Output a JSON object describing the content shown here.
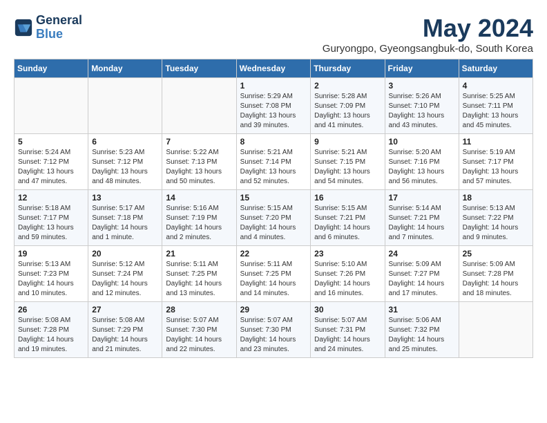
{
  "logo": {
    "line1": "General",
    "line2": "Blue"
  },
  "title": "May 2024",
  "subtitle": "Guryongpo, Gyeongsangbuk-do, South Korea",
  "weekdays": [
    "Sunday",
    "Monday",
    "Tuesday",
    "Wednesday",
    "Thursday",
    "Friday",
    "Saturday"
  ],
  "weeks": [
    [
      {
        "day": "",
        "sunrise": "",
        "sunset": "",
        "daylight": ""
      },
      {
        "day": "",
        "sunrise": "",
        "sunset": "",
        "daylight": ""
      },
      {
        "day": "",
        "sunrise": "",
        "sunset": "",
        "daylight": ""
      },
      {
        "day": "1",
        "sunrise": "Sunrise: 5:29 AM",
        "sunset": "Sunset: 7:08 PM",
        "daylight": "Daylight: 13 hours and 39 minutes."
      },
      {
        "day": "2",
        "sunrise": "Sunrise: 5:28 AM",
        "sunset": "Sunset: 7:09 PM",
        "daylight": "Daylight: 13 hours and 41 minutes."
      },
      {
        "day": "3",
        "sunrise": "Sunrise: 5:26 AM",
        "sunset": "Sunset: 7:10 PM",
        "daylight": "Daylight: 13 hours and 43 minutes."
      },
      {
        "day": "4",
        "sunrise": "Sunrise: 5:25 AM",
        "sunset": "Sunset: 7:11 PM",
        "daylight": "Daylight: 13 hours and 45 minutes."
      }
    ],
    [
      {
        "day": "5",
        "sunrise": "Sunrise: 5:24 AM",
        "sunset": "Sunset: 7:12 PM",
        "daylight": "Daylight: 13 hours and 47 minutes."
      },
      {
        "day": "6",
        "sunrise": "Sunrise: 5:23 AM",
        "sunset": "Sunset: 7:12 PM",
        "daylight": "Daylight: 13 hours and 48 minutes."
      },
      {
        "day": "7",
        "sunrise": "Sunrise: 5:22 AM",
        "sunset": "Sunset: 7:13 PM",
        "daylight": "Daylight: 13 hours and 50 minutes."
      },
      {
        "day": "8",
        "sunrise": "Sunrise: 5:21 AM",
        "sunset": "Sunset: 7:14 PM",
        "daylight": "Daylight: 13 hours and 52 minutes."
      },
      {
        "day": "9",
        "sunrise": "Sunrise: 5:21 AM",
        "sunset": "Sunset: 7:15 PM",
        "daylight": "Daylight: 13 hours and 54 minutes."
      },
      {
        "day": "10",
        "sunrise": "Sunrise: 5:20 AM",
        "sunset": "Sunset: 7:16 PM",
        "daylight": "Daylight: 13 hours and 56 minutes."
      },
      {
        "day": "11",
        "sunrise": "Sunrise: 5:19 AM",
        "sunset": "Sunset: 7:17 PM",
        "daylight": "Daylight: 13 hours and 57 minutes."
      }
    ],
    [
      {
        "day": "12",
        "sunrise": "Sunrise: 5:18 AM",
        "sunset": "Sunset: 7:17 PM",
        "daylight": "Daylight: 13 hours and 59 minutes."
      },
      {
        "day": "13",
        "sunrise": "Sunrise: 5:17 AM",
        "sunset": "Sunset: 7:18 PM",
        "daylight": "Daylight: 14 hours and 1 minute."
      },
      {
        "day": "14",
        "sunrise": "Sunrise: 5:16 AM",
        "sunset": "Sunset: 7:19 PM",
        "daylight": "Daylight: 14 hours and 2 minutes."
      },
      {
        "day": "15",
        "sunrise": "Sunrise: 5:15 AM",
        "sunset": "Sunset: 7:20 PM",
        "daylight": "Daylight: 14 hours and 4 minutes."
      },
      {
        "day": "16",
        "sunrise": "Sunrise: 5:15 AM",
        "sunset": "Sunset: 7:21 PM",
        "daylight": "Daylight: 14 hours and 6 minutes."
      },
      {
        "day": "17",
        "sunrise": "Sunrise: 5:14 AM",
        "sunset": "Sunset: 7:21 PM",
        "daylight": "Daylight: 14 hours and 7 minutes."
      },
      {
        "day": "18",
        "sunrise": "Sunrise: 5:13 AM",
        "sunset": "Sunset: 7:22 PM",
        "daylight": "Daylight: 14 hours and 9 minutes."
      }
    ],
    [
      {
        "day": "19",
        "sunrise": "Sunrise: 5:13 AM",
        "sunset": "Sunset: 7:23 PM",
        "daylight": "Daylight: 14 hours and 10 minutes."
      },
      {
        "day": "20",
        "sunrise": "Sunrise: 5:12 AM",
        "sunset": "Sunset: 7:24 PM",
        "daylight": "Daylight: 14 hours and 12 minutes."
      },
      {
        "day": "21",
        "sunrise": "Sunrise: 5:11 AM",
        "sunset": "Sunset: 7:25 PM",
        "daylight": "Daylight: 14 hours and 13 minutes."
      },
      {
        "day": "22",
        "sunrise": "Sunrise: 5:11 AM",
        "sunset": "Sunset: 7:25 PM",
        "daylight": "Daylight: 14 hours and 14 minutes."
      },
      {
        "day": "23",
        "sunrise": "Sunrise: 5:10 AM",
        "sunset": "Sunset: 7:26 PM",
        "daylight": "Daylight: 14 hours and 16 minutes."
      },
      {
        "day": "24",
        "sunrise": "Sunrise: 5:09 AM",
        "sunset": "Sunset: 7:27 PM",
        "daylight": "Daylight: 14 hours and 17 minutes."
      },
      {
        "day": "25",
        "sunrise": "Sunrise: 5:09 AM",
        "sunset": "Sunset: 7:28 PM",
        "daylight": "Daylight: 14 hours and 18 minutes."
      }
    ],
    [
      {
        "day": "26",
        "sunrise": "Sunrise: 5:08 AM",
        "sunset": "Sunset: 7:28 PM",
        "daylight": "Daylight: 14 hours and 19 minutes."
      },
      {
        "day": "27",
        "sunrise": "Sunrise: 5:08 AM",
        "sunset": "Sunset: 7:29 PM",
        "daylight": "Daylight: 14 hours and 21 minutes."
      },
      {
        "day": "28",
        "sunrise": "Sunrise: 5:07 AM",
        "sunset": "Sunset: 7:30 PM",
        "daylight": "Daylight: 14 hours and 22 minutes."
      },
      {
        "day": "29",
        "sunrise": "Sunrise: 5:07 AM",
        "sunset": "Sunset: 7:30 PM",
        "daylight": "Daylight: 14 hours and 23 minutes."
      },
      {
        "day": "30",
        "sunrise": "Sunrise: 5:07 AM",
        "sunset": "Sunset: 7:31 PM",
        "daylight": "Daylight: 14 hours and 24 minutes."
      },
      {
        "day": "31",
        "sunrise": "Sunrise: 5:06 AM",
        "sunset": "Sunset: 7:32 PM",
        "daylight": "Daylight: 14 hours and 25 minutes."
      },
      {
        "day": "",
        "sunrise": "",
        "sunset": "",
        "daylight": ""
      }
    ]
  ]
}
